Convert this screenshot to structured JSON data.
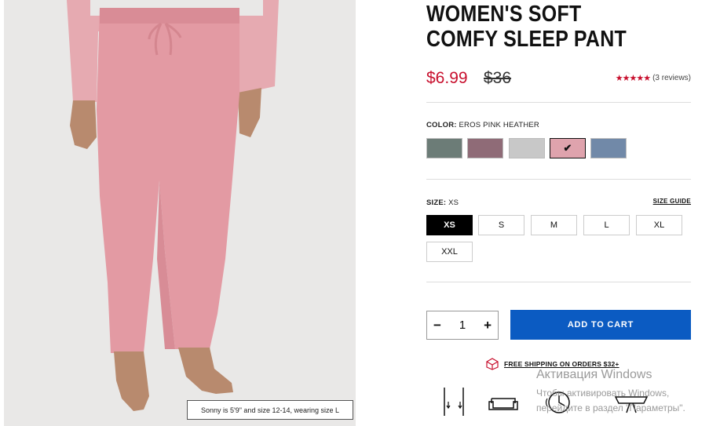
{
  "product": {
    "title": "WOMEN'S SOFT COMFY SLEEP PANT",
    "price_sale": "$6.99",
    "price_original": "$36",
    "rating_stars": "★★★★★",
    "reviews": "(3 reviews)"
  },
  "image": {
    "caption": "Sonny is 5'9\" and size 12-14, wearing size L"
  },
  "color": {
    "label": "COLOR:",
    "selected": "EROS PINK HEATHER",
    "swatches": [
      {
        "name": "slate green",
        "hex": "#6c7c77"
      },
      {
        "name": "mauve",
        "hex": "#8f6b77"
      },
      {
        "name": "light gray",
        "hex": "#c8c8c8"
      },
      {
        "name": "eros pink heather",
        "hex": "#dfa3ad",
        "selected": true
      },
      {
        "name": "blue gray",
        "hex": "#7189a8"
      }
    ]
  },
  "size": {
    "label": "SIZE:",
    "selected": "XS",
    "guide": "SIZE GUIDE",
    "options": [
      "XS",
      "S",
      "M",
      "L",
      "XL",
      "XXL"
    ]
  },
  "quantity": {
    "minus": "−",
    "value": "1",
    "plus": "+"
  },
  "cart": {
    "button": "ADD TO CART"
  },
  "shipping": {
    "text": "FREE SHIPPING ON ORDERS $32+"
  },
  "watermark": {
    "line1": "Активация Windows",
    "line2": "Чтобы активировать Windows, перейдите в раздел \"Параметры\"."
  },
  "colors": {
    "sale": "#c8102e",
    "cta": "#0b5bc2"
  }
}
